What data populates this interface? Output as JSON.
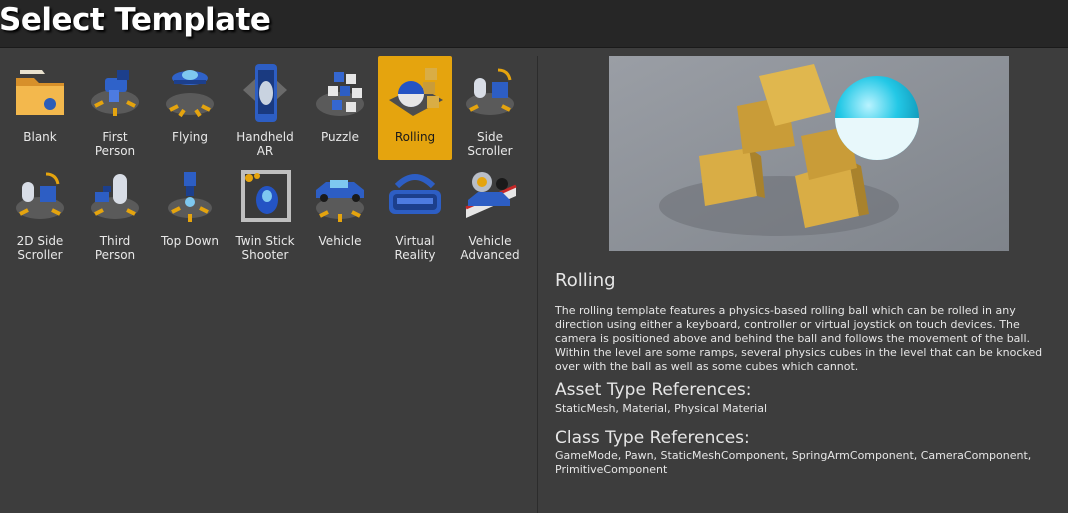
{
  "header": {
    "title": "Select Template"
  },
  "templates": [
    {
      "label": "Blank",
      "icon": "folder-icon"
    },
    {
      "label": "First\nPerson",
      "icon": "first-person-icon"
    },
    {
      "label": "Flying",
      "icon": "flying-ship-icon"
    },
    {
      "label": "Handheld\nAR",
      "icon": "handheld-ar-icon"
    },
    {
      "label": "Puzzle",
      "icon": "puzzle-cubes-icon"
    },
    {
      "label": "Rolling",
      "icon": "rolling-ball-icon",
      "selected": true
    },
    {
      "label": "Side\nScroller",
      "icon": "side-scroller-icon"
    },
    {
      "label": "2D Side\nScroller",
      "icon": "2d-side-scroller-icon"
    },
    {
      "label": "Third\nPerson",
      "icon": "third-person-icon"
    },
    {
      "label": "Top Down",
      "icon": "top-down-icon"
    },
    {
      "label": "Twin Stick\nShooter",
      "icon": "twin-stick-shooter-icon"
    },
    {
      "label": "Vehicle",
      "icon": "vehicle-icon"
    },
    {
      "label": "Virtual\nReality",
      "icon": "vr-headset-icon"
    },
    {
      "label": "Vehicle\nAdvanced",
      "icon": "vehicle-advanced-icon"
    }
  ],
  "detail": {
    "title": "Rolling",
    "description": "The rolling template features a physics-based rolling ball which can be rolled in any direction using either a keyboard, controller or virtual joystick on touch devices. The camera is positioned above and behind the ball and follows the movement of the ball. Within the level are some ramps, several physics cubes in the level that can be knocked over with the ball as well as some cubes which cannot.",
    "asset_heading": "Asset Type References:",
    "asset_text": "StaticMesh, Material, Physical Material",
    "class_heading": "Class Type References:",
    "class_text": "GameMode, Pawn, StaticMeshComponent, SpringArmComponent, CameraComponent, PrimitiveComponent"
  },
  "colors": {
    "selection": "#e5a40e",
    "accent_blue": "#3a6fd8",
    "cube_gold": "#d9ad45",
    "ball_cyan": "#23c8e6"
  }
}
